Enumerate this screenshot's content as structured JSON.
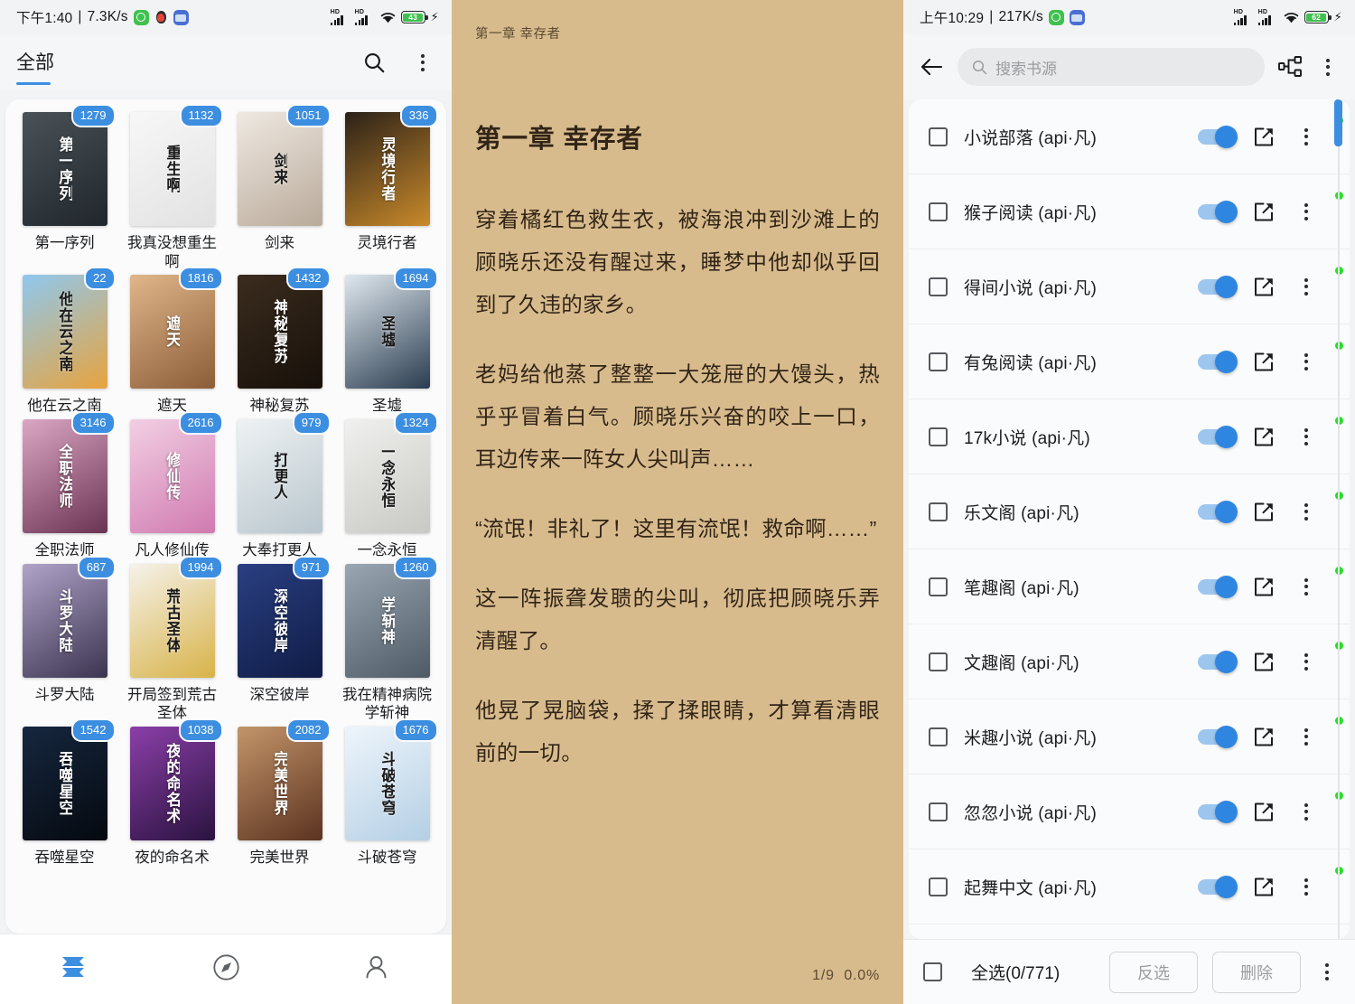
{
  "panel1": {
    "statusbar": {
      "time": "下午1:40",
      "separator": "|",
      "network_speed": "7.3K/s",
      "battery_level": "43",
      "icons": [
        "app-green-icon",
        "qq-icon",
        "app-blue-icon",
        "signal-hd-icon",
        "signal-hd-icon",
        "wifi-icon",
        "battery-icon",
        "charging-bolt-icon"
      ]
    },
    "topbar": {
      "tab_label": "全部",
      "search_icon": "search-icon",
      "overflow_icon": "kebab-menu-icon"
    },
    "books": [
      {
        "badge": "1279",
        "title": "第一序列",
        "cover_text": "第一序列",
        "c1": "#4a5258",
        "c2": "#20262b",
        "light": false
      },
      {
        "badge": "1132",
        "title": "我真没想重生啊",
        "cover_text": "重生啊",
        "c1": "#f7f7f7",
        "c2": "#e2e2e2",
        "light": true
      },
      {
        "badge": "1051",
        "title": "剑来",
        "cover_text": "剑来",
        "c1": "#efe9e2",
        "c2": "#b9aa9a",
        "light": true
      },
      {
        "badge": "336",
        "title": "灵境行者",
        "cover_text": "灵境行者",
        "c1": "#2b2118",
        "c2": "#c98a2a",
        "light": false
      },
      {
        "badge": "22",
        "title": "他在云之南",
        "cover_text": "他在云之南",
        "c1": "#8fc8ef",
        "c2": "#e8a33d",
        "light": true
      },
      {
        "badge": "1816",
        "title": "遮天",
        "cover_text": "遮天",
        "c1": "#e0b68a",
        "c2": "#8c5d38",
        "light": false
      },
      {
        "badge": "1432",
        "title": "神秘复苏",
        "cover_text": "神秘复苏",
        "c1": "#3b2c1e",
        "c2": "#17100a",
        "light": false
      },
      {
        "badge": "1694",
        "title": "圣墟",
        "cover_text": "圣墟",
        "c1": "#dfe8ee",
        "c2": "#2a3c50",
        "light": true
      },
      {
        "badge": "3146",
        "title": "全职法师",
        "cover_text": "全职法师",
        "c1": "#dba7c4",
        "c2": "#6b3352",
        "light": false
      },
      {
        "badge": "2616",
        "title": "凡人修仙传",
        "cover_text": "修仙传",
        "c1": "#f2cfe3",
        "c2": "#d07ab0",
        "light": false
      },
      {
        "badge": "979",
        "title": "大奉打更人",
        "cover_text": "打更人",
        "c1": "#eef2f4",
        "c2": "#b9c6cd",
        "light": true
      },
      {
        "badge": "1324",
        "title": "一念永恒",
        "cover_text": "一念永恒",
        "c1": "#f0f0ee",
        "c2": "#c8c8c4",
        "light": true
      },
      {
        "badge": "687",
        "title": "斗罗大陆",
        "cover_text": "斗罗大陆",
        "c1": "#b0a3c8",
        "c2": "#3b3450",
        "light": false
      },
      {
        "badge": "1994",
        "title": "开局签到荒古圣体",
        "cover_text": "荒古圣体",
        "c1": "#f5f2ea",
        "c2": "#d8b349",
        "light": true
      },
      {
        "badge": "971",
        "title": "深空彼岸",
        "cover_text": "深空彼岸",
        "c1": "#2a3f82",
        "c2": "#101c46",
        "light": false
      },
      {
        "badge": "1260",
        "title": "我在精神病院学斩神",
        "cover_text": "学斩神",
        "c1": "#9aa7b2",
        "c2": "#4e5a66",
        "light": false
      },
      {
        "badge": "1542",
        "title": "吞噬星空",
        "cover_text": "吞噬星空",
        "c1": "#16273f",
        "c2": "#05090f",
        "light": false
      },
      {
        "badge": "1038",
        "title": "夜的命名术",
        "cover_text": "夜的命名术",
        "c1": "#8b3fa8",
        "c2": "#2a1340",
        "light": false
      },
      {
        "badge": "2082",
        "title": "完美世界",
        "cover_text": "完美世界",
        "c1": "#c4956a",
        "c2": "#5b3320",
        "light": false
      },
      {
        "badge": "1676",
        "title": "斗破苍穹",
        "cover_text": "斗破苍穹",
        "c1": "#eef5fb",
        "c2": "#b4cfe4",
        "light": true
      }
    ],
    "bottom_nav": [
      {
        "name": "shelf-tab",
        "icon": "bookshelf-icon",
        "active": true
      },
      {
        "name": "discover-tab",
        "icon": "compass-icon",
        "active": false
      },
      {
        "name": "profile-tab",
        "icon": "person-icon",
        "active": false
      }
    ]
  },
  "panel2": {
    "running_header": "第一章 幸存者",
    "chapter_title": "第一章 幸存者",
    "paragraphs": [
      "穿着橘红色救生衣，被海浪冲到沙滩上的顾晓乐还没有醒过来，睡梦中他却似乎回到了久违的家乡。",
      "老妈给他蒸了整整一大笼屉的大馒头，热乎乎冒着白气。顾晓乐兴奋的咬上一口，耳边传来一阵女人尖叫声……",
      "“流氓！非礼了！这里有流氓！救命啊……”",
      "这一阵振聋发聩的尖叫，彻底把顾晓乐弄清醒了。",
      "他晃了晃脑袋，揉了揉眼睛，才算看清眼前的一切。"
    ],
    "footer_page": "1/9",
    "footer_progress": "0.0%",
    "bg_color": "#d8bb8d",
    "text_color": "#322517"
  },
  "panel3": {
    "statusbar": {
      "time": "上午10:29",
      "separator": "|",
      "network_speed": "217K/s",
      "battery_level": "62"
    },
    "topbar": {
      "back_icon": "back-arrow-icon",
      "search_placeholder": "搜索书源",
      "search_value": "",
      "group_icon": "source-group-icon",
      "overflow_icon": "kebab-menu-icon"
    },
    "sources": [
      {
        "name": "小说部落 (api·凡)",
        "enabled": true,
        "status": "online"
      },
      {
        "name": "猴子阅读 (api·凡)",
        "enabled": true,
        "status": "online"
      },
      {
        "name": "得间小说 (api·凡)",
        "enabled": true,
        "status": "online"
      },
      {
        "name": "有兔阅读 (api·凡)",
        "enabled": true,
        "status": "online"
      },
      {
        "name": "17k小说 (api·凡)",
        "enabled": true,
        "status": "online"
      },
      {
        "name": "乐文阁 (api·凡)",
        "enabled": true,
        "status": "online"
      },
      {
        "name": "笔趣阁 (api·凡)",
        "enabled": true,
        "status": "online"
      },
      {
        "name": "文趣阁 (api·凡)",
        "enabled": true,
        "status": "online"
      },
      {
        "name": "米趣小说 (api·凡)",
        "enabled": true,
        "status": "online"
      },
      {
        "name": "忽忽小说 (api·凡)",
        "enabled": true,
        "status": "online"
      },
      {
        "name": "起舞中文 (api·凡)",
        "enabled": true,
        "status": "online"
      }
    ],
    "bottombar": {
      "select_all_label": "全选(0/771)",
      "invert_label": "反选",
      "delete_label": "删除",
      "overflow_icon": "kebab-menu-icon"
    },
    "accent_color": "#3c8ee0",
    "status_dot_color": "#29dd29"
  }
}
